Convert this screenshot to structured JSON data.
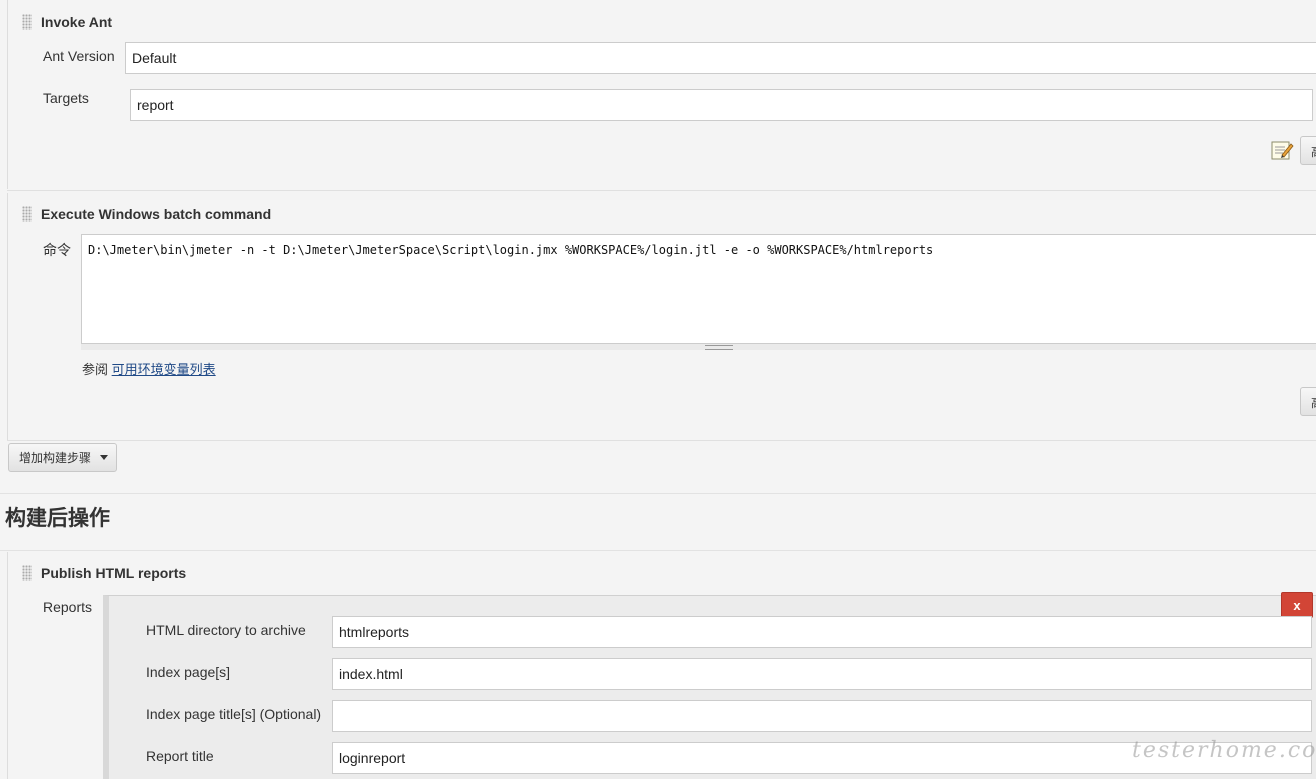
{
  "ant_section": {
    "title": "Invoke Ant",
    "ant_version_label": "Ant Version",
    "ant_version_value": "Default",
    "targets_label": "Targets",
    "targets_value": "report",
    "advanced_button": "高"
  },
  "batch_section": {
    "title": "Execute Windows batch command",
    "command_label": "命令",
    "command_value": "D:\\Jmeter\\bin\\jmeter -n -t D:\\Jmeter\\JmeterSpace\\Script\\login.jmx %WORKSPACE%/login.jtl -e -o %WORKSPACE%/htmlreports",
    "see_label": "参阅",
    "env_link": "可用环境变量列表",
    "advanced_button": "高"
  },
  "add_step_button": "增加构建步骤",
  "post_build_title": "构建后操作",
  "publish_section": {
    "title": "Publish HTML reports",
    "reports_label": "Reports",
    "delete_button": "x",
    "fields": {
      "dir_label": "HTML directory to archive",
      "dir_value": "htmlreports",
      "index_label": "Index page[s]",
      "index_value": "index.html",
      "index_title_label": "Index page title[s] (Optional)",
      "index_title_value": "",
      "report_title_label": "Report title",
      "report_title_value": "loginreport"
    }
  },
  "watermark": "testerhome.com"
}
